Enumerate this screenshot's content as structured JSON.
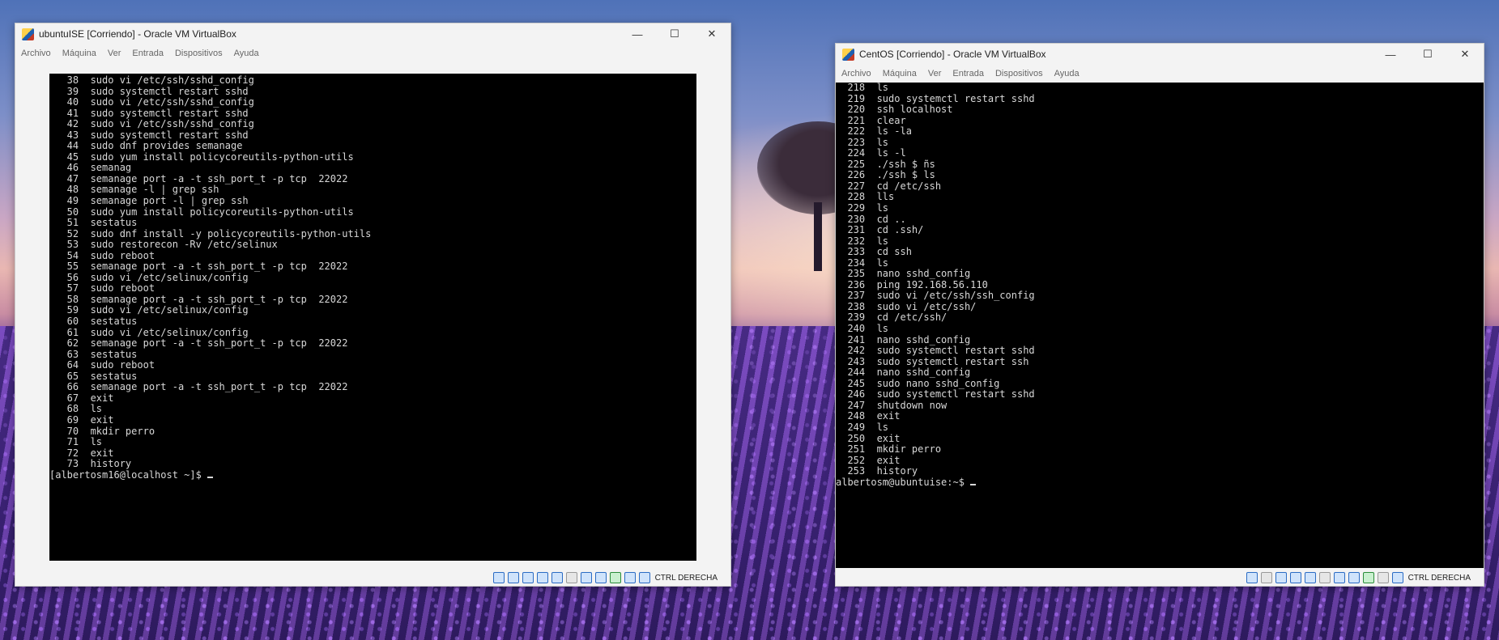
{
  "desktop": {
    "wallpaper": "lavender-field-tree"
  },
  "ubuntu_window": {
    "title": "ubuntuISE [Corriendo] - Oracle VM VirtualBox",
    "menu": [
      "Archivo",
      "Máquina",
      "Ver",
      "Entrada",
      "Dispositivos",
      "Ayuda"
    ],
    "terminal_lines": [
      "   38  sudo vi /etc/ssh/sshd_config",
      "   39  sudo systemctl restart sshd",
      "   40  sudo vi /etc/ssh/sshd_config",
      "   41  sudo systemctl restart sshd",
      "   42  sudo vi /etc/ssh/sshd_config",
      "   43  sudo systemctl restart sshd",
      "   44  sudo dnf provides semanage",
      "   45  sudo yum install policycoreutils-python-utils",
      "   46  semanag",
      "   47  semanage port -a -t ssh_port_t -p tcp  22022",
      "   48  semanage -l | grep ssh",
      "   49  semanage port -l | grep ssh",
      "   50  sudo yum install policycoreutils-python-utils",
      "   51  sestatus",
      "   52  sudo dnf install -y policycoreutils-python-utils",
      "   53  sudo restorecon -Rv /etc/selinux",
      "   54  sudo reboot",
      "   55  semanage port -a -t ssh_port_t -p tcp  22022",
      "   56  sudo vi /etc/selinux/config",
      "   57  sudo reboot",
      "   58  semanage port -a -t ssh_port_t -p tcp  22022",
      "   59  sudo vi /etc/selinux/config",
      "   60  sestatus",
      "   61  sudo vi /etc/selinux/config",
      "   62  semanage port -a -t ssh_port_t -p tcp  22022",
      "   63  sestatus",
      "   64  sudo reboot",
      "   65  sestatus",
      "   66  semanage port -a -t ssh_port_t -p tcp  22022",
      "   67  exit",
      "   68  ls",
      "   69  exit",
      "   70  mkdir perro",
      "   71  ls",
      "   72  exit",
      "   73  history"
    ],
    "prompt": "[albertosm16@localhost ~]$ ",
    "host_key": "CTRL DERECHA"
  },
  "centos_window": {
    "title": "CentOS [Corriendo] - Oracle VM VirtualBox",
    "menu": [
      "Archivo",
      "Máquina",
      "Ver",
      "Entrada",
      "Dispositivos",
      "Ayuda"
    ],
    "terminal_lines": [
      "  218  ls",
      "  219  sudo systemctl restart sshd",
      "  220  ssh localhost",
      "  221  clear",
      "  222  ls -la",
      "  223  ls",
      "  224  ls -l",
      "  225  ./ssh $ ñs",
      "  226  ./ssh $ ls",
      "  227  cd /etc/ssh",
      "  228  lls",
      "  229  ls",
      "  230  cd ..",
      "  231  cd .ssh/",
      "  232  ls",
      "  233  cd ssh",
      "  234  ls",
      "  235  nano sshd_config",
      "  236  ping 192.168.56.110",
      "  237  sudo vi /etc/ssh/ssh_config",
      "  238  sudo vi /etc/ssh/",
      "  239  cd /etc/ssh/",
      "  240  ls",
      "  241  nano sshd_config",
      "  242  sudo systemctl restart sshd",
      "  243  sudo systemctl restart ssh",
      "  244  nano sshd_config",
      "  245  sudo nano sshd_config",
      "  246  sudo systemctl restart sshd",
      "  247  shutdown now",
      "  248  exit",
      "  249  ls",
      "  250  exit",
      "  251  mkdir perro",
      "  252  exit",
      "  253  history"
    ],
    "prompt": "albertosm@ubuntuise:~$ ",
    "host_key": "CTRL DERECHA"
  },
  "window_controls": {
    "minimize": "—",
    "maximize": "☐",
    "close": "✕"
  }
}
